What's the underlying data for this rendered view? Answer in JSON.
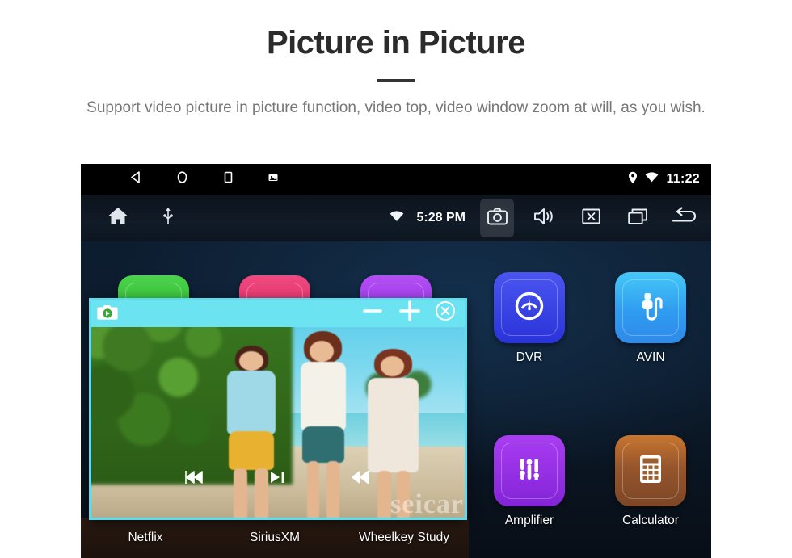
{
  "promo": {
    "title": "Picture in Picture",
    "subtitle": "Support video picture in picture function, video top, video window zoom at will, as you wish."
  },
  "device": {
    "status_bar": {
      "nav_icons": [
        "back-triangle-icon",
        "home-circle-icon",
        "recents-square-icon",
        "screenshot-icon"
      ],
      "right_icons": [
        "location-pin-icon",
        "wifi-icon"
      ],
      "time": "11:22"
    },
    "toolbar": {
      "left_icons": [
        "home-icon",
        "usb-icon"
      ],
      "wifi_icon": "wifi-icon",
      "clock": "5:28 PM",
      "buttons": [
        {
          "name": "camera-button",
          "icon": "camera-icon",
          "active": true
        },
        {
          "name": "volume-button",
          "icon": "speaker-icon",
          "active": false
        },
        {
          "name": "close-button",
          "icon": "close-box-icon",
          "active": false
        },
        {
          "name": "recent-apps-button",
          "icon": "recent-apps-icon",
          "active": false
        },
        {
          "name": "back-button",
          "icon": "back-arrow-icon",
          "active": false
        }
      ]
    },
    "apps": [
      {
        "label": "DVR",
        "icon": "gauge-icon",
        "color": "#3340e0",
        "accent": "#5b63f5"
      },
      {
        "label": "AVIN",
        "icon": "av-connector-icon",
        "color": "#2f9cf0",
        "accent": "#3ec8f5"
      },
      {
        "label": "Amplifier",
        "icon": "equalizer-icon",
        "color": "#8a2ce0",
        "accent": "#b44df5"
      },
      {
        "label": "Calculator",
        "icon": "calculator-icon",
        "color": "#9c5f33",
        "accent": "#e08a3c"
      }
    ],
    "hidden_apps": [
      {
        "label": "Netflix",
        "color": "#1faa1f",
        "accent": "#4cd34c"
      },
      {
        "label": "SiriusXM",
        "color": "#d81b5e",
        "accent": "#f0497f"
      },
      {
        "label": "Wheelkey Study",
        "color": "#8a2ce0",
        "accent": "#b44df5"
      }
    ],
    "bottom_labels": [
      "Netflix",
      "SiriusXM",
      "Wheelkey Study"
    ],
    "pip": {
      "camera_icon": "video-camera-icon",
      "zoom_out_label": "−",
      "zoom_in_label": "+",
      "close_label": "×",
      "bar_color": "#6be3f0",
      "frame_color": "#5fdcec",
      "watermark": "seicar",
      "media_controls": [
        "previous-track-icon",
        "play-pause-icon",
        "next-track-icon"
      ]
    }
  }
}
